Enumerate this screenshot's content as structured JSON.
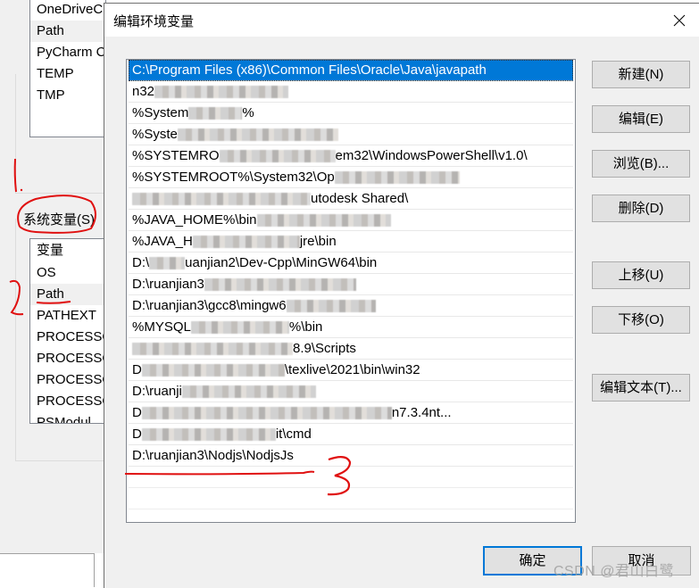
{
  "background_dialog": {
    "user_vars_list": [
      {
        "name": "OneDriveC",
        "selected": false
      },
      {
        "name": "Path",
        "selected": true
      },
      {
        "name": "PyCharm C",
        "selected": false
      },
      {
        "name": "TEMP",
        "selected": false
      },
      {
        "name": "TMP",
        "selected": false
      }
    ],
    "system_vars_label": "系统变量(S)",
    "system_vars_header": "变量",
    "system_vars_list": [
      {
        "name": "OS",
        "selected": false
      },
      {
        "name": "Path",
        "selected": true
      },
      {
        "name": "PATHEXT",
        "selected": false
      },
      {
        "name": "PROCESSO",
        "selected": false
      },
      {
        "name": "PROCESSO",
        "selected": false
      },
      {
        "name": "PROCESSO",
        "selected": false
      },
      {
        "name": "PROCESSO",
        "selected": false
      },
      {
        "name": "PSModul",
        "selected": false
      }
    ]
  },
  "dialog": {
    "title": "编辑环境变量",
    "close_icon": "close-icon",
    "path_entries": [
      {
        "visible_text": "C:\\Program Files (x86)\\Common Files\\Oracle\\Java\\javapath",
        "selected": true,
        "obscured_prefix": false
      },
      {
        "visible_text": "n32",
        "selected": false,
        "obscured_prefix": true
      },
      {
        "visible_text": "%System",
        "suffix": "%",
        "selected": false,
        "obscured_middle": true
      },
      {
        "visible_text": "%Syste",
        "selected": false,
        "obscured_suffix": true
      },
      {
        "visible_text": "%SYSTEMRO",
        "suffix": "em32\\WindowsPowerShell\\v1.0\\",
        "selected": false,
        "obscured_middle": true
      },
      {
        "visible_text": "%SYSTEMROOT%\\System32\\Op",
        "selected": false,
        "obscured_suffix": true
      },
      {
        "visible_text": "",
        "suffix": "utodesk Shared\\",
        "selected": false,
        "obscured_prefix": true
      },
      {
        "visible_text": "%JAVA_HOME%\\bin",
        "selected": false,
        "obscured_partial": true
      },
      {
        "visible_text": "%JAVA_H",
        "suffix": "jre\\bin",
        "selected": false,
        "obscured_middle": true
      },
      {
        "visible_text": "D:\\",
        "suffix": "uanjian2\\Dev-Cpp\\MinGW64\\bin",
        "selected": false,
        "obscured_middle": true
      },
      {
        "visible_text": "D:\\ruanjian3",
        "selected": false,
        "obscured_suffix": true
      },
      {
        "visible_text": "D:\\ruanjian3\\gcc8\\mingw6",
        "selected": false,
        "obscured_suffix": true
      },
      {
        "visible_text": "%MYSQL",
        "suffix": "%\\bin",
        "selected": false,
        "obscured_middle": true
      },
      {
        "visible_text": "",
        "suffix": "8.9\\Scripts",
        "selected": false,
        "obscured_prefix": true
      },
      {
        "visible_text": "D",
        "suffix": "\\texlive\\2021\\bin\\win32",
        "selected": false,
        "obscured_middle": true
      },
      {
        "visible_text": "D:\\ruanji",
        "selected": false,
        "obscured_suffix": true
      },
      {
        "visible_text": "D",
        "suffix": "n7.3.4nt...",
        "selected": false,
        "obscured_middle": true
      },
      {
        "visible_text": "D",
        "suffix": "it\\cmd",
        "selected": false,
        "obscured_middle": true
      },
      {
        "visible_text": "D:\\ruanjian3\\Nodjs\\NodjsJs",
        "selected": false,
        "obscured_prefix": false
      }
    ],
    "empty_rows": 3,
    "buttons": {
      "new": "新建(N)",
      "edit": "编辑(E)",
      "browse": "浏览(B)...",
      "delete": "删除(D)",
      "move_up": "上移(U)",
      "move_down": "下移(O)",
      "edit_text": "编辑文本(T)...",
      "ok": "确定",
      "cancel": "取消"
    }
  },
  "annotations": {
    "labels": [
      "1.",
      "2",
      "3"
    ],
    "color": "#e01010"
  },
  "watermark": "CSDN @君山白鹭",
  "colors": {
    "selection": "#0078d7",
    "dialog_bg": "#f0f0f0",
    "button_bg": "#e1e1e1",
    "annotation": "#e01010"
  }
}
